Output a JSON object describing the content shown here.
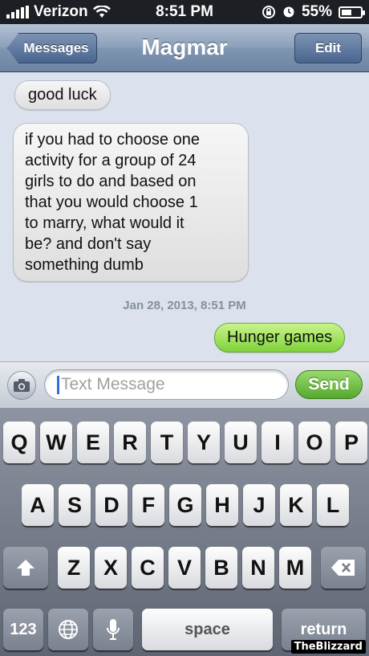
{
  "status_bar": {
    "carrier": "Verizon",
    "time": "8:51 PM",
    "battery": "55%",
    "battery_level": 0.55,
    "icons": [
      "signal-bars-icon",
      "wifi-icon",
      "rotation-lock-icon",
      "alarm-icon",
      "battery-icon"
    ]
  },
  "nav": {
    "back_label": "Messages",
    "title": "Magmar",
    "edit_label": "Edit"
  },
  "messages": [
    {
      "direction": "incoming",
      "text": "good luck"
    },
    {
      "direction": "incoming",
      "lines": [
        "if you had to choose one",
        "activity for a group of 24",
        "girls to do and based on",
        "that you would choose 1",
        "to marry, what would it",
        "be? and don't say",
        "something dumb"
      ]
    },
    {
      "direction": "outgoing",
      "text": "Hunger games"
    }
  ],
  "timestamp": "Jan 28, 2013, 8:51 PM",
  "composer": {
    "placeholder": "Text Message",
    "send_label": "Send"
  },
  "keyboard": {
    "row1": [
      "Q",
      "W",
      "E",
      "R",
      "T",
      "Y",
      "U",
      "I",
      "O",
      "P"
    ],
    "row2": [
      "A",
      "S",
      "D",
      "F",
      "G",
      "H",
      "J",
      "K",
      "L"
    ],
    "row3": [
      "Z",
      "X",
      "C",
      "V",
      "B",
      "N",
      "M"
    ],
    "numbers_label": "123",
    "space_label": "space",
    "return_label": "return"
  },
  "watermark": "TheBlizzard",
  "colors": {
    "outgoing_bubble": "#7fd23b",
    "send_button": "#56a82e",
    "nav_bar": "#7f95b1"
  }
}
